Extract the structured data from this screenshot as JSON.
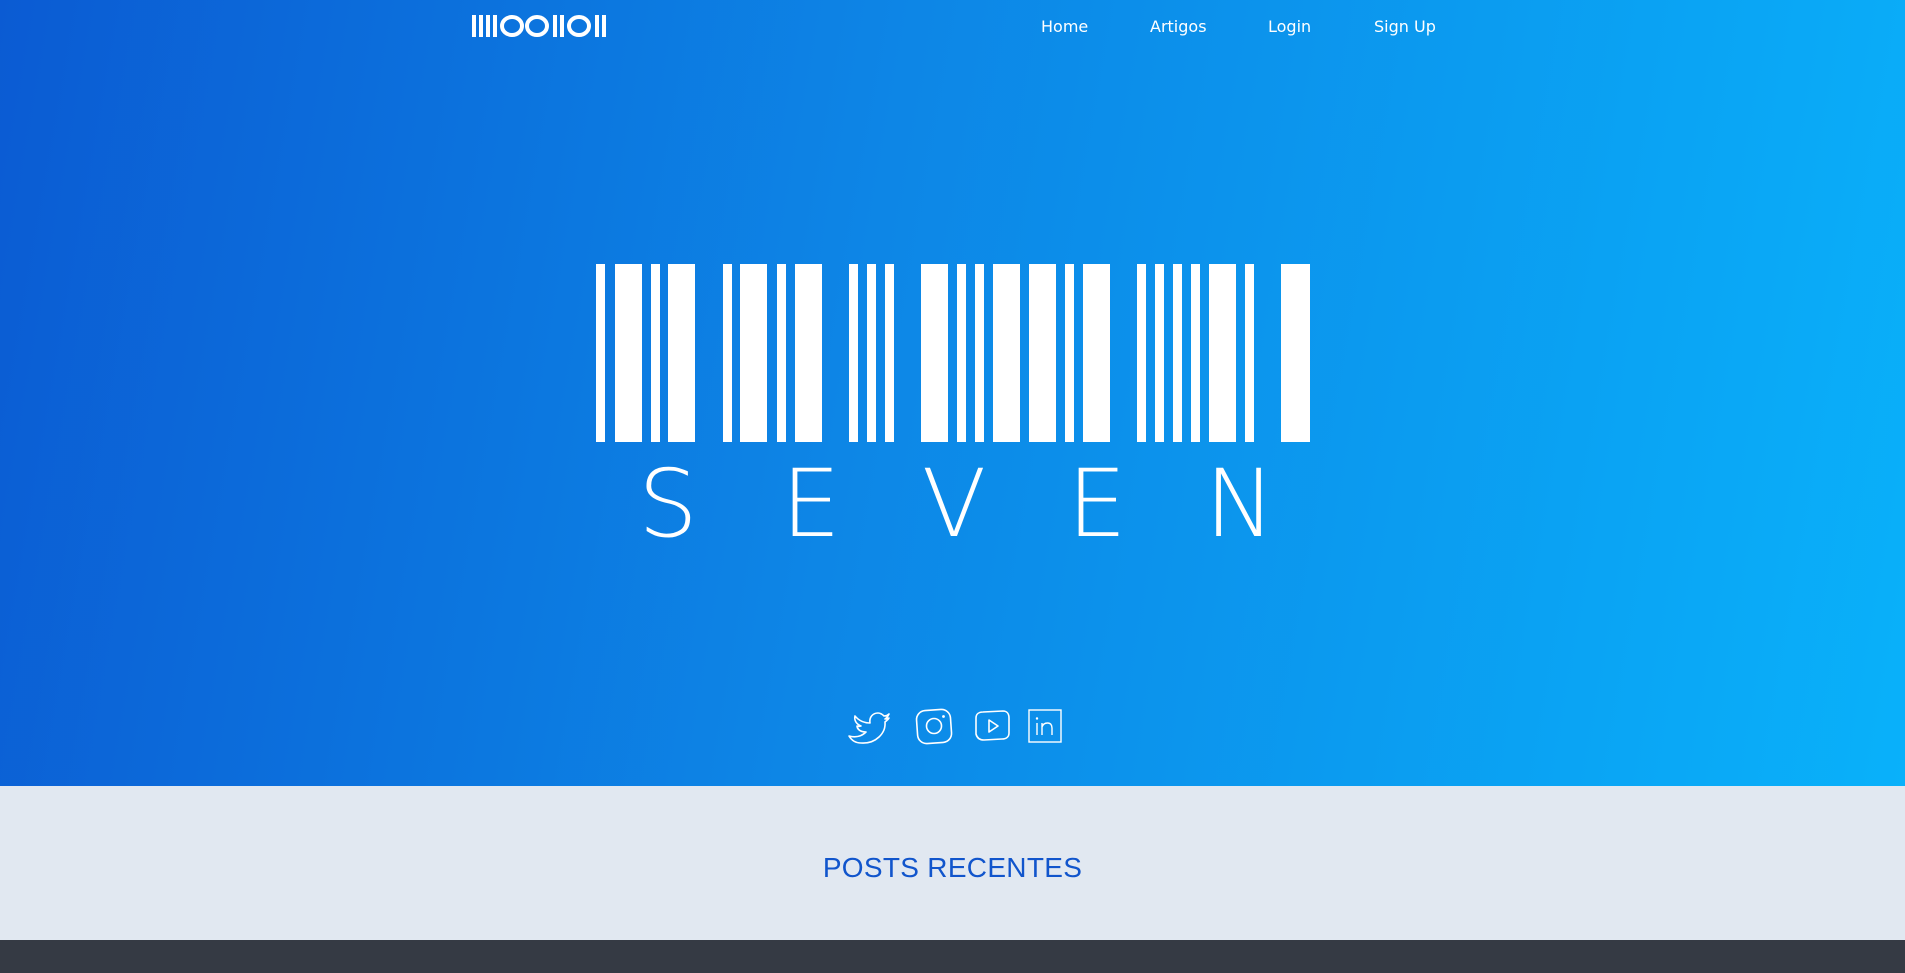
{
  "nav": {
    "logo_text": "IIIIOOIIOII",
    "items": [
      {
        "label": "Home"
      },
      {
        "label": "Artigos"
      },
      {
        "label": "Login"
      },
      {
        "label": "Sign Up"
      }
    ]
  },
  "hero": {
    "brand_word": "SEVEN",
    "social_icons": [
      "twitter-icon",
      "instagram-icon",
      "youtube-icon",
      "linkedin-icon"
    ]
  },
  "recent_posts": {
    "title": "POSTS RECENTES"
  },
  "colors": {
    "hero_gradient_start": "#0b5bd3",
    "hero_gradient_end": "#09b1fa",
    "section_bg": "#e1e8f1",
    "title_blue": "#1155cc",
    "footer_bg": "#353a44"
  }
}
